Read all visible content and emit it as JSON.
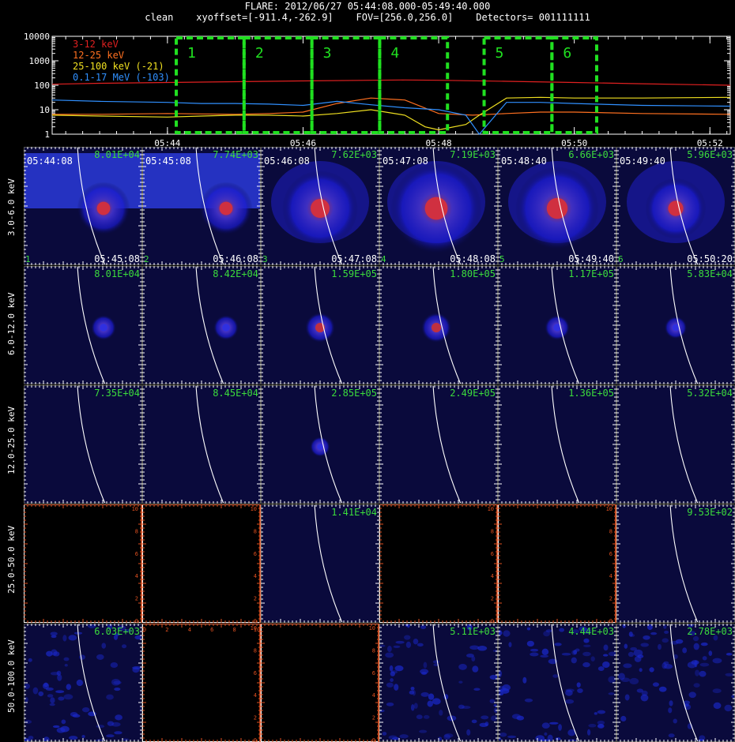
{
  "header": {
    "line1": "FLARE: 2012/06/27 05:44:08.000-05:49:40.000",
    "line2": "clean    xyoffset=[-911.4,-262.9]    FOV=[256.0,256.0]    Detectors= 001111111"
  },
  "chart_data": [
    {
      "type": "line",
      "name": "lightcurve",
      "y_scale": "log",
      "ylim": [
        1,
        10000
      ],
      "y_ticks": [
        "10000",
        "1000",
        "100",
        "10",
        "1"
      ],
      "x_ticks": [
        "05:44",
        "05:46",
        "05:48",
        "05:50",
        "05:52"
      ],
      "x_tick_values": [
        44,
        46,
        48,
        50,
        52
      ],
      "xlim": [
        42.3,
        52.3
      ],
      "series": [
        {
          "name": "3-12 keV",
          "color": "#e02020",
          "x": [
            42.3,
            43,
            44,
            45,
            46,
            47,
            47.5,
            48,
            49,
            50,
            51,
            52.3
          ],
          "y": [
            110,
            120,
            130,
            140,
            150,
            160,
            165,
            160,
            145,
            130,
            115,
            100
          ]
        },
        {
          "name": "12-25 keV",
          "color": "#ff7020",
          "x": [
            42.3,
            43,
            44,
            45,
            45.5,
            46,
            46.5,
            47,
            47.5,
            48,
            48.5,
            49,
            49.5,
            50,
            51,
            52.3
          ],
          "y": [
            6.5,
            6.5,
            7,
            6.5,
            7,
            8,
            18,
            30,
            25,
            7,
            6,
            7,
            8,
            8,
            7,
            6.5
          ]
        },
        {
          "name": "25-100 keV (-21)",
          "color": "#f0e020",
          "x": [
            42.3,
            43,
            44,
            44.5,
            45,
            45.5,
            46,
            46.5,
            47,
            47.5,
            47.8,
            48,
            48.4,
            48.6,
            49,
            49.5,
            50,
            51,
            52.3
          ],
          "y": [
            6,
            5.5,
            5,
            5.5,
            6,
            6,
            5.5,
            7,
            10,
            6,
            2,
            1.5,
            2.5,
            6,
            30,
            32,
            30,
            30,
            32
          ]
        },
        {
          "name": "0.1-17 MeV (-103)",
          "color": "#3090ff",
          "x": [
            42.3,
            43,
            44,
            44.5,
            45,
            45.5,
            46,
            46.5,
            47,
            47.5,
            48,
            48.4,
            48.6,
            49,
            49.5,
            50,
            51,
            52.3
          ],
          "y": [
            25,
            22,
            20,
            18,
            18,
            17,
            15,
            22,
            16,
            12,
            10,
            6,
            1,
            20,
            20,
            18,
            15,
            14
          ]
        }
      ],
      "intervals": [
        {
          "label": "1",
          "x0": 44.13,
          "x1": 45.13
        },
        {
          "label": "2",
          "x0": 45.13,
          "x1": 46.13
        },
        {
          "label": "3",
          "x0": 46.13,
          "x1": 47.13
        },
        {
          "label": "4",
          "x0": 47.13,
          "x1": 48.13
        },
        {
          "label": "5",
          "x0": 48.67,
          "x1": 49.67
        },
        {
          "label": "6",
          "x0": 49.67,
          "x1": 50.33
        }
      ]
    },
    {
      "type": "heatmap",
      "name": "image-grid",
      "rows": [
        "3.0-6.0 keV",
        "6.0-12.0 keV",
        "12.0-25.0 keV",
        "25.0-50.0 keV",
        "50.0-100.0 keV"
      ],
      "columns": [
        {
          "index": "1",
          "start": "05:44:08",
          "end": "05:45:08"
        },
        {
          "index": "2",
          "start": "05:45:08",
          "end": "05:46:08"
        },
        {
          "index": "3",
          "start": "05:46:08",
          "end": "05:47:08"
        },
        {
          "index": "4",
          "start": "05:47:08",
          "end": "05:48:08"
        },
        {
          "index": "5",
          "start": "05:48:40",
          "end": "05:49:40"
        },
        {
          "index": "6",
          "start": "05:49:40",
          "end": "05:50:20"
        }
      ],
      "peaks": [
        [
          "8.01E+04",
          "7.74E+03",
          "7.62E+03",
          "7.19E+03",
          "6.66E+03",
          "5.96E+03"
        ],
        [
          "8.01E+04",
          "8.42E+04",
          "1.59E+05",
          "1.80E+05",
          "1.17E+05",
          "5.83E+04"
        ],
        [
          "7.35E+04",
          "8.45E+04",
          "2.85E+05",
          "2.49E+05",
          "1.36E+05",
          "5.32E+04"
        ],
        [
          "",
          "",
          "1.41E+04",
          "",
          "",
          "9.53E+02"
        ],
        [
          "6.03E+03",
          "",
          "",
          "5.11E+03",
          "4.44E+03",
          "2.78E+03"
        ]
      ],
      "empty_axis_ticks": [
        "0",
        "2",
        "4",
        "6",
        "8",
        "10"
      ]
    }
  ]
}
